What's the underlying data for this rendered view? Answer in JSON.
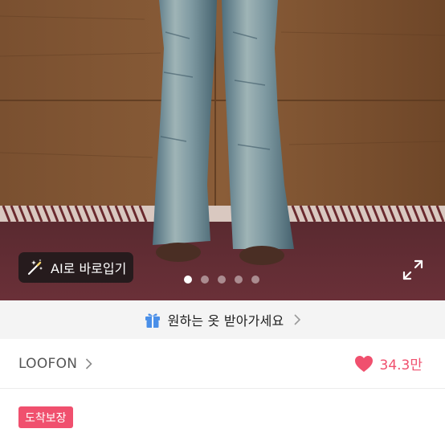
{
  "photo": {
    "ai_button_label": "AI로 바로입기",
    "ai_icon": "magic-wand-icon",
    "expand_icon": "expand-icon",
    "pagination": {
      "total": 5,
      "current": 1
    }
  },
  "banner": {
    "icon": "gift-icon",
    "text": "원하는 옷 받아가세요"
  },
  "brand": {
    "name": "LOOFON",
    "like_count": "34.3만",
    "like_icon": "heart-icon"
  },
  "badge": {
    "label": "도착보장"
  },
  "colors": {
    "accent": "#f0506e",
    "banner_bg": "#f4f4f4",
    "brand_text": "#555555"
  }
}
